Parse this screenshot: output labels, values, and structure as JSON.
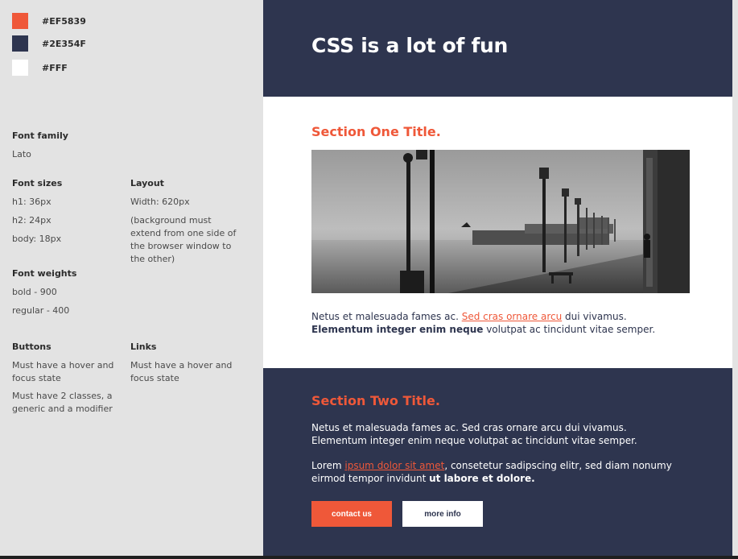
{
  "palette": [
    {
      "hex": "#EF5839",
      "label": "#EF5839"
    },
    {
      "hex": "#2E354F",
      "label": "#2E354F"
    },
    {
      "hex": "#FFFFFF",
      "label": "#FFF"
    }
  ],
  "spec": {
    "font_family": {
      "title": "Font family",
      "value": "Lato"
    },
    "font_sizes": {
      "title": "Font sizes",
      "h1": "h1: 36px",
      "h2": "h2: 24px",
      "body": "body: 18px"
    },
    "layout": {
      "title": "Layout",
      "width": "Width: 620px",
      "note": "(background must extend from one side of the browser window to the other)"
    },
    "font_weights": {
      "title": "Font weights",
      "bold": "bold - 900",
      "regular": "regular - 400"
    },
    "buttons": {
      "title": "Buttons",
      "line1": "Must have a hover and focus state",
      "line2": "Must have 2 classes, a generic and a modifier"
    },
    "links": {
      "title": "Links",
      "line1": "Must have a hover and focus state"
    }
  },
  "hero": {
    "title": "CSS is a lot of fun"
  },
  "section_one": {
    "title": "Section One Title.",
    "text_a": "Netus et malesuada fames ac. ",
    "link": "Sed cras ornare arcu",
    "text_b": " dui vivamus. ",
    "bold": "Elementum integer enim neque",
    "text_c": " volutpat ac tincidunt vitae semper."
  },
  "section_two": {
    "title": "Section Two Title.",
    "paragraph1": "Netus et malesuada fames ac. Sed cras ornare arcu dui vivamus. Elementum integer enim neque volutpat ac tincidunt vitae semper.",
    "p2_a": "Lorem ",
    "p2_link": "ipsum dolor sit amet",
    "p2_b": ", consetetur sadipscing elitr, sed diam nonumy eirmod tempor invidunt ",
    "p2_bold": "ut labore et dolore.",
    "button_primary": "contact us",
    "button_secondary": "more info"
  },
  "colors": {
    "accent": "#EF5839",
    "dark": "#2E354F",
    "panel": "#e3e3e3"
  }
}
